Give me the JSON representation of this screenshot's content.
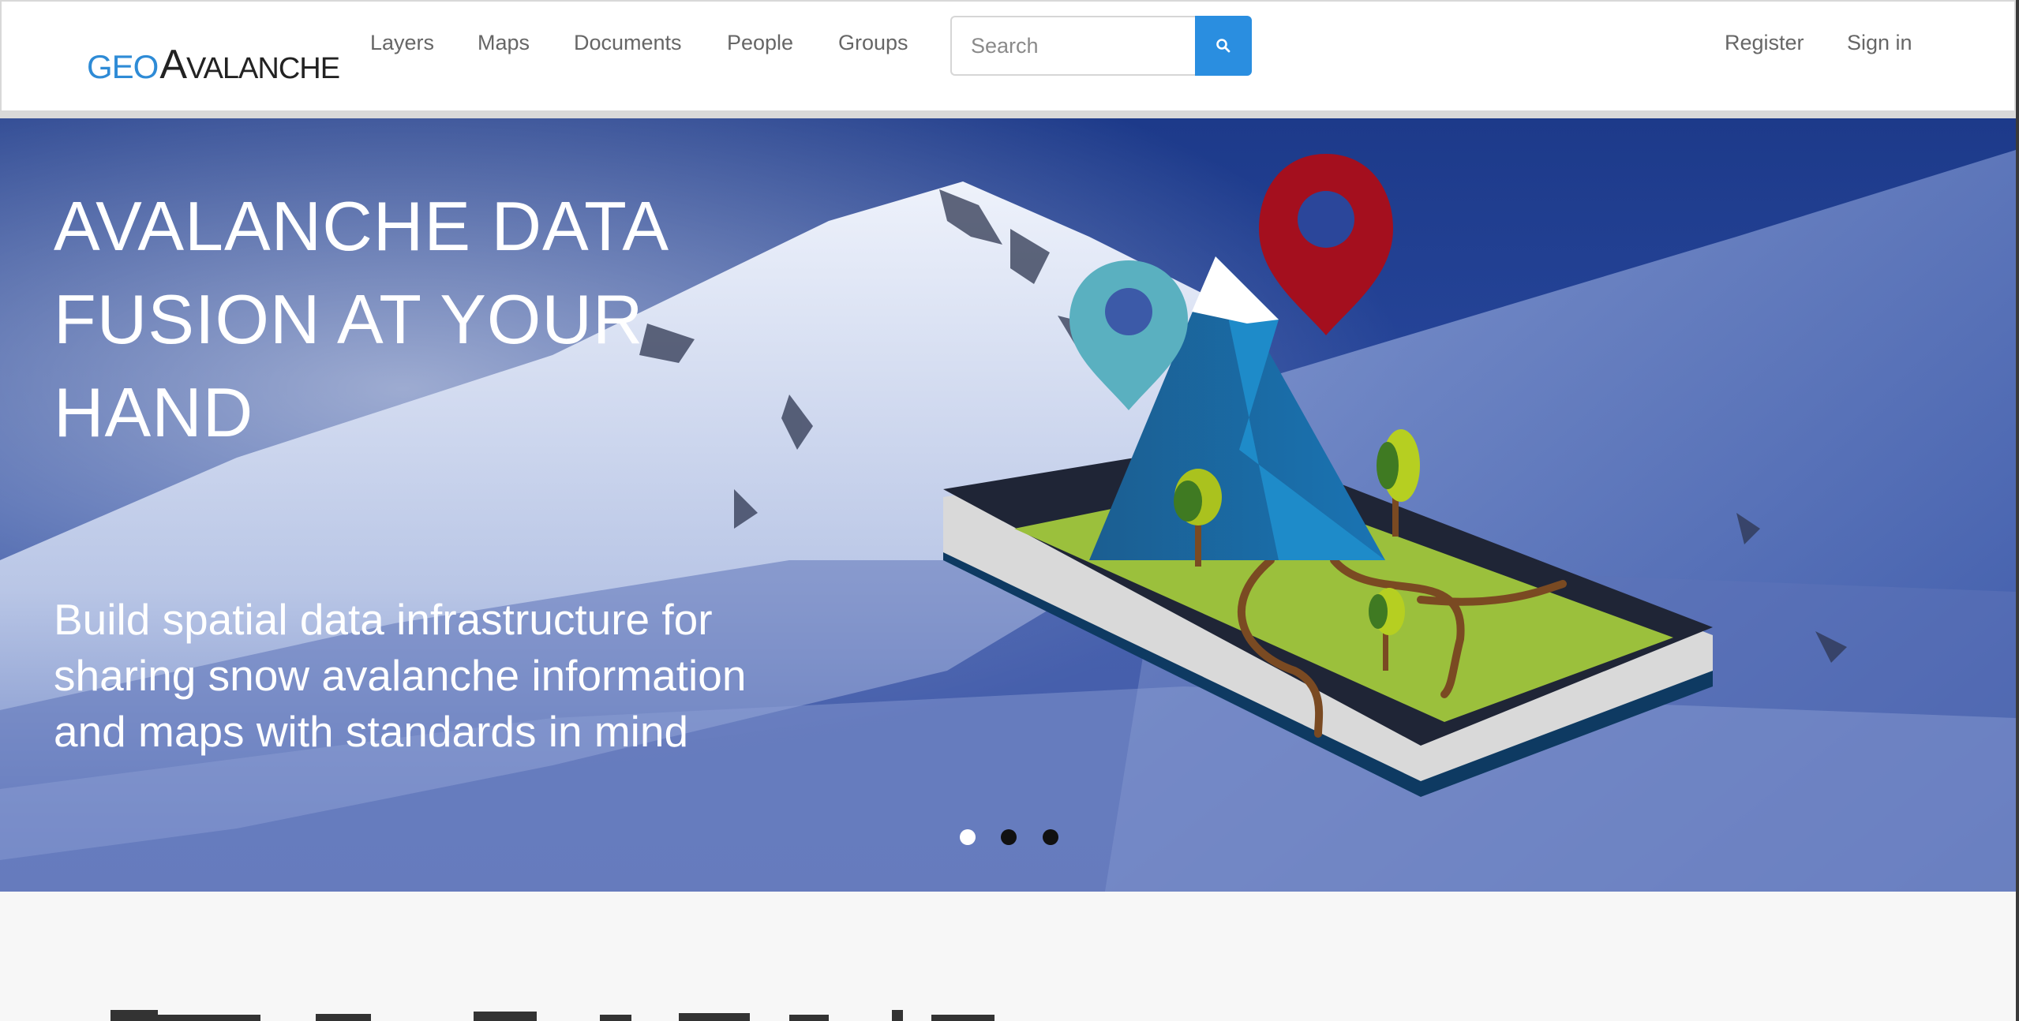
{
  "brand": {
    "geo": "GEO",
    "a": "A",
    "rest": "VALANCHE",
    "colors": {
      "geo": "#2e8bd6",
      "rest": "#222222"
    }
  },
  "nav": {
    "items": [
      "Layers",
      "Maps",
      "Documents",
      "People",
      "Groups"
    ],
    "register": "Register",
    "signin": "Sign in"
  },
  "search": {
    "placeholder": "Search",
    "button_icon": "search-icon",
    "button_color": "#2a8ee0"
  },
  "hero": {
    "title": "AVALANCHE DATA FUSION AT YOUR HAND",
    "subtitle": "Build spatial data infrastructure for sharing snow avalanche information and maps with standards in mind",
    "carousel": {
      "count": 3,
      "active": 0
    }
  }
}
